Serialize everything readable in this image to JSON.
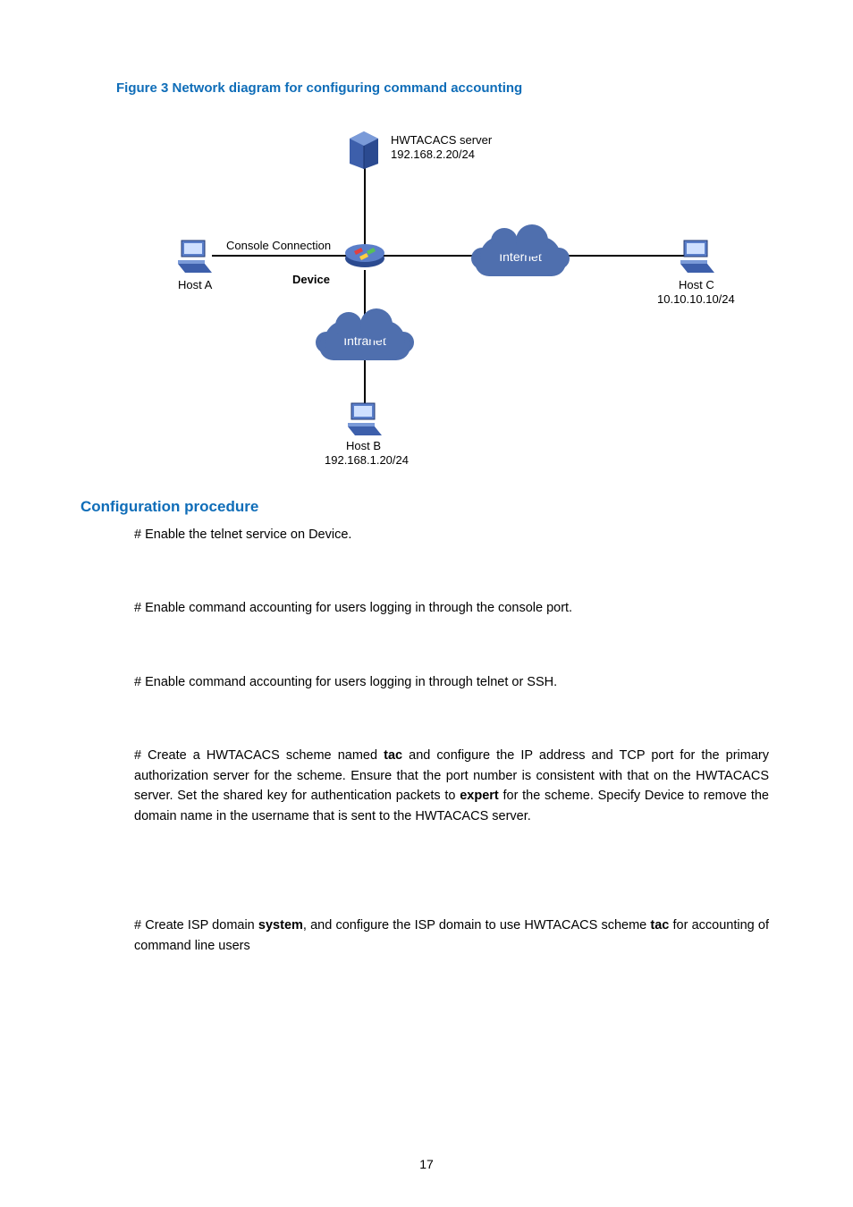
{
  "figure": {
    "caption": "Figure 3 Network diagram for configuring command accounting",
    "labels": {
      "hwtacacs_name": "HWTACACS server",
      "hwtacacs_ip": "192.168.2.20/24",
      "console_conn": "Console Connection",
      "device": "Device",
      "host_a": "Host A",
      "host_c": "Host C",
      "host_c_ip": "10.10.10.10/24",
      "internet": "Internet",
      "intranet": "Intranet",
      "host_b": "Host B",
      "host_b_ip": "192.168.1.20/24"
    }
  },
  "section_heading": "Configuration procedure",
  "paragraphs": {
    "p1": "# Enable the telnet service on Device.",
    "p2": "# Enable command accounting for users logging in through the console port.",
    "p3": "# Enable command accounting for users logging in through telnet or SSH.",
    "p4_a": "# Create a HWTACACS scheme named ",
    "p4_b": "tac",
    "p4_c": " and configure the IP address and TCP port for the primary authorization server for the scheme. Ensure that the port number is consistent with that on the HWTACACS server. Set the shared key for authentication packets to ",
    "p4_d": "expert",
    "p4_e": " for the scheme. Specify Device to remove the domain name in the username that is sent to the HWTACACS server.",
    "p5_a": "# Create ISP domain ",
    "p5_b": "system",
    "p5_c": ", and configure the ISP domain to use HWTACACS scheme ",
    "p5_d": "tac",
    "p5_e": " for accounting of command line users"
  },
  "page_number": "17"
}
